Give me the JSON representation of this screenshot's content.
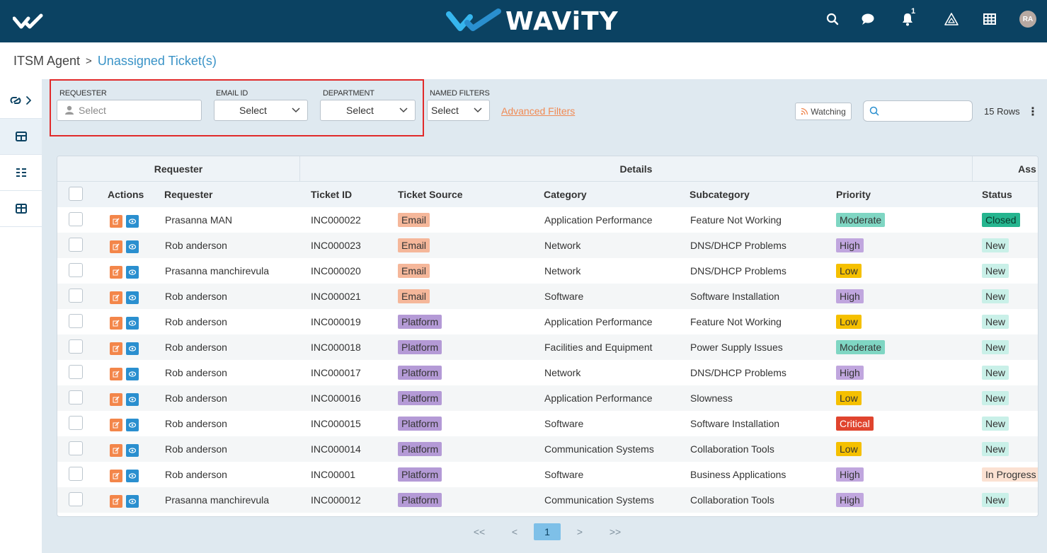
{
  "app": {
    "brand_name": "WAViTY",
    "bell_count": "1",
    "avatar_initials": "RA"
  },
  "breadcrumb": {
    "root": "ITSM Agent",
    "separator": ">",
    "current": "Unassigned Ticket(s)"
  },
  "filters": {
    "requester_label": "REQUESTER",
    "requester_placeholder": "Select",
    "email_label": "EMAIL ID",
    "email_value": "Select",
    "department_label": "DEPARTMENT",
    "department_value": "Select",
    "named_filters_label": "NAMED FILTERS",
    "named_filters_value": "Select",
    "advanced_filters": "Advanced Filters",
    "watching": "Watching",
    "search_placeholder": "",
    "rows": "15 Rows"
  },
  "table": {
    "groups": [
      "Requester",
      "Details",
      "Ass"
    ],
    "columns": [
      "Actions",
      "Requester",
      "Ticket ID",
      "Ticket Source",
      "Category",
      "Subcategory",
      "Priority",
      "Status"
    ],
    "rows": [
      {
        "requester": "Prasanna MAN",
        "ticket_id": "INC000022",
        "source": "Email",
        "category": "Application Performance",
        "subcategory": "Feature Not Working",
        "priority": "Moderate",
        "status": "Closed"
      },
      {
        "requester": "Rob anderson",
        "ticket_id": "INC000023",
        "source": "Email",
        "category": "Network",
        "subcategory": "DNS/DHCP Problems",
        "priority": "High",
        "status": "New"
      },
      {
        "requester": "Prasanna manchirevula",
        "ticket_id": "INC000020",
        "source": "Email",
        "category": "Network",
        "subcategory": "DNS/DHCP Problems",
        "priority": "Low",
        "status": "New"
      },
      {
        "requester": "Rob anderson",
        "ticket_id": "INC000021",
        "source": "Email",
        "category": "Software",
        "subcategory": "Software Installation",
        "priority": "High",
        "status": "New"
      },
      {
        "requester": "Rob anderson",
        "ticket_id": "INC000019",
        "source": "Platform",
        "category": "Application Performance",
        "subcategory": "Feature Not Working",
        "priority": "Low",
        "status": "New"
      },
      {
        "requester": "Rob anderson",
        "ticket_id": "INC000018",
        "source": "Platform",
        "category": "Facilities and Equipment",
        "subcategory": "Power Supply Issues",
        "priority": "Moderate",
        "status": "New"
      },
      {
        "requester": "Rob anderson",
        "ticket_id": "INC000017",
        "source": "Platform",
        "category": "Network",
        "subcategory": "DNS/DHCP Problems",
        "priority": "High",
        "status": "New"
      },
      {
        "requester": "Rob anderson",
        "ticket_id": "INC000016",
        "source": "Platform",
        "category": "Application Performance",
        "subcategory": "Slowness",
        "priority": "Low",
        "status": "New"
      },
      {
        "requester": "Rob anderson",
        "ticket_id": "INC000015",
        "source": "Platform",
        "category": "Software",
        "subcategory": "Software Installation",
        "priority": "Critical",
        "status": "New"
      },
      {
        "requester": "Rob anderson",
        "ticket_id": "INC000014",
        "source": "Platform",
        "category": "Communication Systems",
        "subcategory": "Collaboration Tools",
        "priority": "Low",
        "status": "New"
      },
      {
        "requester": "Rob anderson",
        "ticket_id": "INC00001",
        "source": "Platform",
        "category": "Software",
        "subcategory": "Business Applications",
        "priority": "High",
        "status": "In Progress"
      },
      {
        "requester": "Prasanna manchirevula",
        "ticket_id": "INC000012",
        "source": "Platform",
        "category": "Communication Systems",
        "subcategory": "Collaboration Tools",
        "priority": "High",
        "status": "New"
      }
    ]
  },
  "pagination": {
    "first": "<<",
    "prev": "<",
    "current": "1",
    "next": ">",
    "last": ">>"
  },
  "colors": {
    "topbar": "#0b4262",
    "accent": "#3a93c7",
    "source_email": "#f5b79a",
    "source_platform": "#b49ad6",
    "priority_moderate": "#7fd6c3",
    "priority_high": "#c0a6de",
    "priority_low": "#f5c000",
    "priority_critical": "#e0442e",
    "status_closed": "#25b58f",
    "status_new": "#c9f0e8",
    "status_in_progress": "#fbe1d2"
  }
}
